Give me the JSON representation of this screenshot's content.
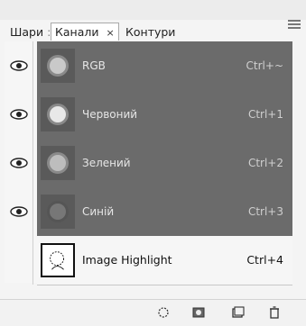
{
  "tabs": [
    {
      "label": "Шари"
    },
    {
      "label": "Канали",
      "active": true,
      "close": "×"
    },
    {
      "label": "Контури"
    }
  ],
  "channels": [
    {
      "name": "RGB",
      "shortcut": "Ctrl+~",
      "icon": "eye-icon"
    },
    {
      "name": "Червоний",
      "shortcut": "Ctrl+1",
      "icon": "eye-icon"
    },
    {
      "name": "Зелений",
      "shortcut": "Ctrl+2",
      "icon": "eye-icon"
    },
    {
      "name": "Синій",
      "shortcut": "Ctrl+3",
      "icon": "eye-icon"
    },
    {
      "name": "Image Highlight",
      "shortcut": "Ctrl+4"
    }
  ],
  "toolbar": {
    "icons": [
      "load-selection-icon",
      "save-selection-icon",
      "new-channel-icon",
      "delete-channel-icon"
    ]
  },
  "colors": {
    "selected_row": "#6b6b6b",
    "panel_bg": "#f4f4f4"
  }
}
